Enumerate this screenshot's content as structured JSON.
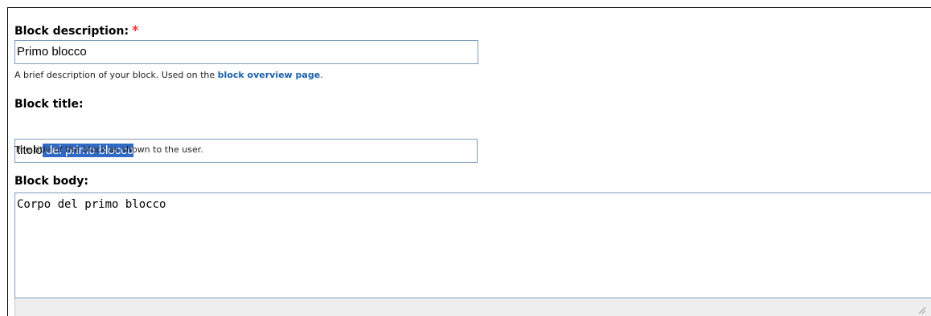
{
  "block_description": {
    "label": "Block description:",
    "required_marker": "*",
    "value": "Primo blocco",
    "help_prefix": "A brief description of your block. Used on the ",
    "help_link": "block overview page",
    "help_suffix": "."
  },
  "block_title": {
    "label": "Block title:",
    "value_unselected": "titolo",
    "value_selected": " del primo blocco",
    "help": "The title of the block as shown to the user."
  },
  "block_body": {
    "label": "Block body:",
    "value": "Corpo del primo blocco"
  },
  "colors": {
    "required": "#e8352b",
    "link": "#1b5faa",
    "selection": "#316ac5",
    "input_border": "#7e9db9"
  },
  "icons": [
    "resize-grip-icon"
  ]
}
